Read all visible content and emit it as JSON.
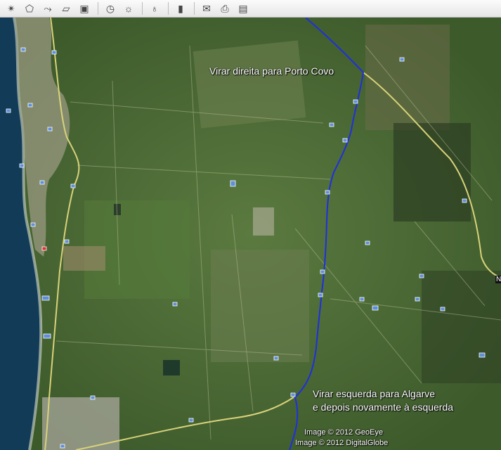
{
  "toolbar": {
    "buttons": [
      {
        "name": "add-placemark",
        "icon": "pushpin-star-icon",
        "glyph": "✴"
      },
      {
        "name": "add-polygon",
        "icon": "polygon-icon",
        "glyph": "⬠"
      },
      {
        "name": "add-path",
        "icon": "path-icon",
        "glyph": "⤳"
      },
      {
        "name": "add-image-overlay",
        "icon": "image-overlay-icon",
        "glyph": "▱"
      },
      {
        "name": "record-tour",
        "icon": "camera-icon",
        "glyph": "▣"
      },
      {
        "name": "historical-imagery",
        "icon": "clock-icon",
        "glyph": "◷"
      },
      {
        "name": "sunlight",
        "icon": "sun-icon",
        "glyph": "☼"
      },
      {
        "name": "switch-sky",
        "icon": "planet-icon",
        "glyph": "♁"
      },
      {
        "name": "ruler",
        "icon": "ruler-icon",
        "glyph": "▮"
      },
      {
        "name": "email",
        "icon": "envelope-icon",
        "glyph": "✉"
      },
      {
        "name": "print",
        "icon": "printer-icon",
        "glyph": "⎙"
      },
      {
        "name": "view-in-maps",
        "icon": "map-icon",
        "glyph": "▤"
      }
    ]
  },
  "map": {
    "labels": {
      "top_instruction": "Virar direita para Porto Covo",
      "bottom_instruction_line1": "Virar esquerda para Algarve",
      "bottom_instruction_line2": "e depois novamente à esquerda",
      "road_marker": "N"
    },
    "credits": {
      "line1": "Image © 2012 GeoEye",
      "line2": "Image © 2012 DigitalGlobe"
    },
    "colors": {
      "route": "#1f2fe0",
      "road": "#d8d27a",
      "ocean": "#123b57",
      "vegetation": "#4d6b35"
    }
  }
}
